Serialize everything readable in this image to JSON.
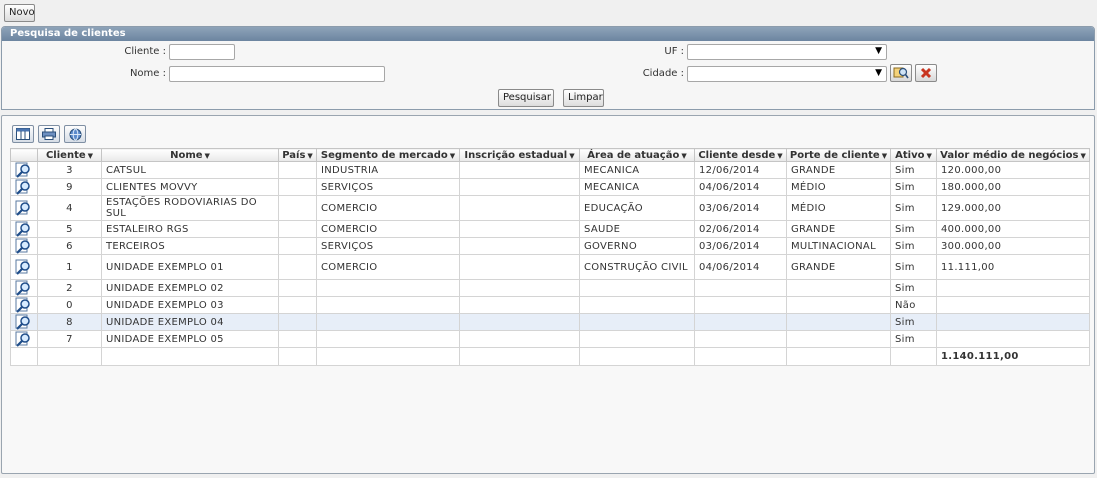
{
  "toolbar": {
    "novo": "Novo"
  },
  "search": {
    "title": "Pesquisa de clientes",
    "cliente_label": "Cliente :",
    "cliente_value": "",
    "nome_label": "Nome :",
    "nome_value": "",
    "uf_label": "UF :",
    "uf_value": "",
    "cidade_label": "Cidade :",
    "cidade_value": "",
    "pesquisar": "Pesquisar",
    "limpar": "Limpar"
  },
  "grid": {
    "headers": [
      "Cliente",
      "Nome",
      "País",
      "Segmento de mercado",
      "Inscrição estadual",
      "Área de atuação",
      "Cliente desde",
      "Porte de cliente",
      "Ativo",
      "Valor médio de negócios"
    ],
    "rows": [
      {
        "id": "3",
        "nome": "CATSUL",
        "pais": "",
        "segmento": "INDUSTRIA",
        "inscricao": "",
        "area": "MECANICA",
        "desde": "12/06/2014",
        "porte": "GRANDE",
        "ativo": "Sim",
        "valor": "120.000,00"
      },
      {
        "id": "9",
        "nome": "CLIENTES MOVVY",
        "pais": "",
        "segmento": "SERVIÇOS",
        "inscricao": "",
        "area": "MECANICA",
        "desde": "04/06/2014",
        "porte": "MÉDIO",
        "ativo": "Sim",
        "valor": "180.000,00"
      },
      {
        "id": "4",
        "nome": "ESTAÇÕES RODOVIARIAS DO SUL",
        "pais": "",
        "segmento": "COMERCIO",
        "inscricao": "",
        "area": "EDUCAÇÃO",
        "desde": "03/06/2014",
        "porte": "MÉDIO",
        "ativo": "Sim",
        "valor": "129.000,00"
      },
      {
        "id": "5",
        "nome": "ESTALEIRO RGS",
        "pais": "",
        "segmento": "COMERCIO",
        "inscricao": "",
        "area": "SAUDE",
        "desde": "02/06/2014",
        "porte": "GRANDE",
        "ativo": "Sim",
        "valor": "400.000,00"
      },
      {
        "id": "6",
        "nome": "TERCEIROS",
        "pais": "",
        "segmento": "SERVIÇOS",
        "inscricao": "",
        "area": "GOVERNO",
        "desde": "03/06/2014",
        "porte": "MULTINACIONAL",
        "ativo": "Sim",
        "valor": "300.000,00"
      },
      {
        "id": "1",
        "nome": "UNIDADE EXEMPLO 01",
        "pais": "",
        "segmento": "COMERCIO",
        "inscricao": "",
        "area": "CONSTRUÇÃO CIVIL",
        "desde": "04/06/2014",
        "porte": "GRANDE",
        "ativo": "Sim",
        "valor": "11.111,00"
      },
      {
        "id": "2",
        "nome": "UNIDADE EXEMPLO 02",
        "pais": "",
        "segmento": "",
        "inscricao": "",
        "area": "",
        "desde": "",
        "porte": "",
        "ativo": "Sim",
        "valor": ""
      },
      {
        "id": "0",
        "nome": "UNIDADE EXEMPLO 03",
        "pais": "",
        "segmento": "",
        "inscricao": "",
        "area": "",
        "desde": "",
        "porte": "",
        "ativo": "Não",
        "valor": ""
      },
      {
        "id": "8",
        "nome": "UNIDADE EXEMPLO 04",
        "pais": "",
        "segmento": "",
        "inscricao": "",
        "area": "",
        "desde": "",
        "porte": "",
        "ativo": "Sim",
        "valor": ""
      },
      {
        "id": "7",
        "nome": "UNIDADE EXEMPLO 05",
        "pais": "",
        "segmento": "",
        "inscricao": "",
        "area": "",
        "desde": "",
        "porte": "",
        "ativo": "Sim",
        "valor": ""
      }
    ],
    "highlighted_row": 8,
    "total": "1.140.111,00"
  }
}
